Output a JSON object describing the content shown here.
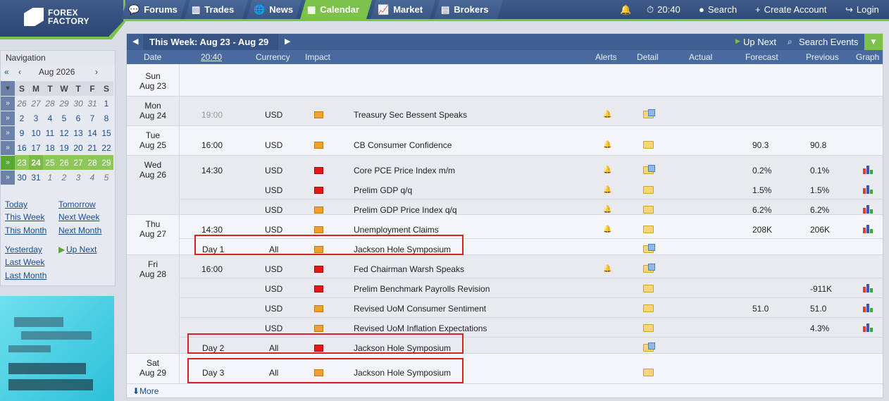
{
  "brand": {
    "line1": "FOREX",
    "line2": "FACTORY"
  },
  "nav": {
    "forums": "Forums",
    "trades": "Trades",
    "news": "News",
    "calendar": "Calendar",
    "market": "Market",
    "brokers": "Brokers"
  },
  "topright": {
    "time": "20:40",
    "search": "Search",
    "create_account": "Create Account",
    "login": "Login"
  },
  "sidebar": {
    "title": "Navigation",
    "month": "Aug 2026",
    "weekday_headers": [
      "S",
      "M",
      "T",
      "W",
      "T",
      "F",
      "S"
    ],
    "weeks": [
      [
        "26",
        "27",
        "28",
        "29",
        "30",
        "31",
        "1"
      ],
      [
        "2",
        "3",
        "4",
        "5",
        "6",
        "7",
        "8"
      ],
      [
        "9",
        "10",
        "11",
        "12",
        "13",
        "14",
        "15"
      ],
      [
        "16",
        "17",
        "18",
        "19",
        "20",
        "21",
        "22"
      ],
      [
        "23",
        "24",
        "25",
        "26",
        "27",
        "28",
        "29"
      ],
      [
        "30",
        "31",
        "1",
        "2",
        "3",
        "4",
        "5"
      ]
    ],
    "links": {
      "today": "Today",
      "tomorrow": "Tomorrow",
      "this_week": "This Week",
      "next_week": "Next Week",
      "this_month": "This Month",
      "next_month": "Next Month",
      "yesterday": "Yesterday",
      "up_next": "Up Next",
      "last_week": "Last Week",
      "last_month": "Last Month"
    }
  },
  "calendar": {
    "week_label": "This Week: Aug 23 - Aug 29",
    "up_next": "Up Next",
    "search_events": "Search Events",
    "headers": {
      "date": "Date",
      "time": "20:40",
      "currency": "Currency",
      "impact": "Impact",
      "alerts": "Alerts",
      "detail": "Detail",
      "actual": "Actual",
      "forecast": "Forecast",
      "previous": "Previous",
      "graph": "Graph"
    },
    "days": [
      {
        "dow": "Sun",
        "date": "Aug 23"
      },
      {
        "dow": "Mon",
        "date": "Aug 24"
      },
      {
        "dow": "Tue",
        "date": "Aug 25"
      },
      {
        "dow": "Wed",
        "date": "Aug 26"
      },
      {
        "dow": "Thu",
        "date": "Aug 27"
      },
      {
        "dow": "Fri",
        "date": "Aug 28"
      },
      {
        "dow": "Sat",
        "date": "Aug 29"
      }
    ],
    "events": [
      {
        "time": "19:00",
        "currency": "USD",
        "impact": "orange",
        "title": "Treasury Sec Bessent Speaks",
        "forecast": "",
        "previous": ""
      },
      {
        "time": "16:00",
        "currency": "USD",
        "impact": "orange",
        "title": "CB Consumer Confidence",
        "forecast": "90.3",
        "previous": "90.8"
      },
      {
        "time": "14:30",
        "currency": "USD",
        "impact": "red",
        "title": "Core PCE Price Index m/m",
        "forecast": "0.2%",
        "previous": "0.1%"
      },
      {
        "time": "",
        "currency": "USD",
        "impact": "red",
        "title": "Prelim GDP q/q",
        "forecast": "1.5%",
        "previous": "1.5%"
      },
      {
        "time": "",
        "currency": "USD",
        "impact": "orange",
        "title": "Prelim GDP Price Index q/q",
        "forecast": "6.2%",
        "previous": "6.2%"
      },
      {
        "time": "14:30",
        "currency": "USD",
        "impact": "orange",
        "title": "Unemployment Claims",
        "forecast": "208K",
        "previous": "206K"
      },
      {
        "time": "Day 1",
        "currency": "All",
        "impact": "orange",
        "title": "Jackson Hole Symposium",
        "forecast": "",
        "previous": ""
      },
      {
        "time": "16:00",
        "currency": "USD",
        "impact": "red",
        "title": "Fed Chairman Warsh Speaks",
        "forecast": "",
        "previous": ""
      },
      {
        "time": "",
        "currency": "USD",
        "impact": "red",
        "title": "Prelim Benchmark Payrolls Revision",
        "forecast": "",
        "previous": "-911K"
      },
      {
        "time": "",
        "currency": "USD",
        "impact": "orange",
        "title": "Revised UoM Consumer Sentiment",
        "forecast": "51.0",
        "previous": "51.0"
      },
      {
        "time": "",
        "currency": "USD",
        "impact": "orange",
        "title": "Revised UoM Inflation Expectations",
        "forecast": "",
        "previous": "4.3%"
      },
      {
        "time": "Day 2",
        "currency": "All",
        "impact": "red",
        "title": "Jackson Hole Symposium",
        "forecast": "",
        "previous": ""
      },
      {
        "time": "Day 3",
        "currency": "All",
        "impact": "orange",
        "title": "Jackson Hole Symposium",
        "forecast": "",
        "previous": ""
      }
    ],
    "more": "More"
  },
  "colors": {
    "topbar": "#2f4b78",
    "accent_green": "#7cc24a",
    "impact_orange": "#f0a030",
    "impact_red": "#e21717",
    "highlight_box": "#d92323"
  }
}
